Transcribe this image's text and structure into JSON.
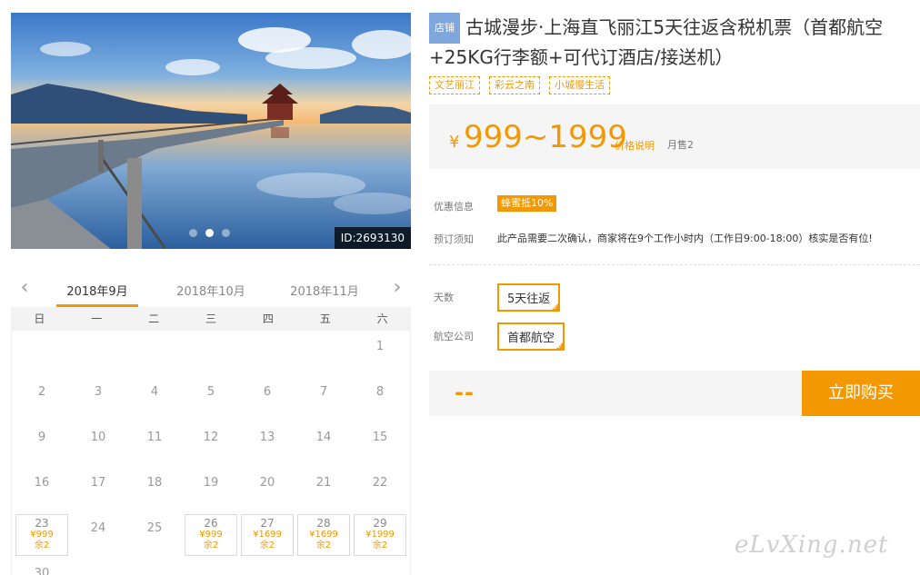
{
  "photo": {
    "id_label": "ID:2693130",
    "slides": 3,
    "active_slide": 2
  },
  "calendar": {
    "months": [
      "2018年9月",
      "2018年10月",
      "2018年11月"
    ],
    "active_month": "2018年9月",
    "weekdays": [
      "日",
      "一",
      "二",
      "三",
      "四",
      "五",
      "六"
    ],
    "days": [
      {
        "day": "1"
      },
      {
        "day": "2"
      },
      {
        "day": "3"
      },
      {
        "day": "4"
      },
      {
        "day": "5"
      },
      {
        "day": "6"
      },
      {
        "day": "7"
      },
      {
        "day": "8"
      },
      {
        "day": "9"
      },
      {
        "day": "10"
      },
      {
        "day": "11"
      },
      {
        "day": "12"
      },
      {
        "day": "13"
      },
      {
        "day": "14"
      },
      {
        "day": "15"
      },
      {
        "day": "16"
      },
      {
        "day": "17"
      },
      {
        "day": "18"
      },
      {
        "day": "19"
      },
      {
        "day": "20"
      },
      {
        "day": "21"
      },
      {
        "day": "22"
      },
      {
        "day": "23",
        "price": "¥999",
        "remain": "余2"
      },
      {
        "day": "24"
      },
      {
        "day": "25"
      },
      {
        "day": "26",
        "price": "¥999",
        "remain": "余2"
      },
      {
        "day": "27",
        "price": "¥1699",
        "remain": "余2"
      },
      {
        "day": "28",
        "price": "¥1699",
        "remain": "余2"
      },
      {
        "day": "29",
        "price": "¥1999",
        "remain": "余2"
      },
      {
        "day": "30"
      }
    ]
  },
  "product": {
    "shop_badge": "店铺",
    "title": "古城漫步·上海直飞丽江5天往返含税机票（首都航空+25KG行李额+可代订酒店/接送机）",
    "tags": [
      "文艺丽江",
      "彩云之南",
      "小城慢生活"
    ],
    "price_currency": "¥",
    "price_range": "999~1999",
    "price_note": "价格说明",
    "monthly_sales": "月售2",
    "promo_label": "优惠信息",
    "promo_badge": "蜂蜜抵10%",
    "notice_label": "预订须知",
    "notice_text": "此产品需要二次确认，商家将在9个工作小时内（工作日9:00-18:00）核实是否有位!",
    "days_label": "天数",
    "days_option": "5天往返",
    "airline_label": "航空公司",
    "airline_option": "首都航空",
    "total": "--",
    "buy_label": "立即购买"
  },
  "watermark": "eLvXing.net",
  "colors": {
    "accent": "#f39800",
    "shop_badge": "#7fa7dd",
    "panel_bg": "#f5f5f5"
  }
}
